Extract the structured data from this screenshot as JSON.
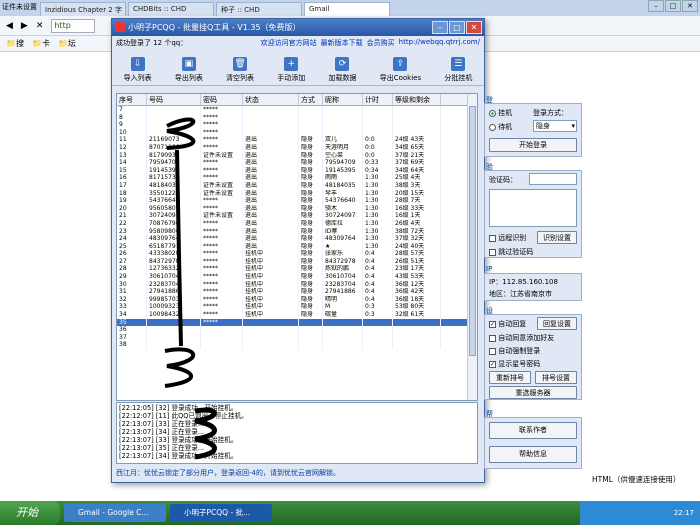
{
  "browser": {
    "window_title": "证件未设置",
    "tabs": [
      "Inzidious Chapter 2 字",
      "CHDBits :: CHD",
      "种子 :: CHD",
      "Gmail"
    ],
    "address_text": "http",
    "bookmarks": [
      "搜",
      "卡",
      "坛"
    ],
    "page_side_text": "HTML（供慢速连接使用）"
  },
  "app": {
    "title": "小明子PCQQ - 批量挂Q工具 - V1.35（免费版）",
    "login_info": "成功登录了 12 个qq：",
    "links": [
      "欢迎访问官方网站",
      "最新版本下载",
      "会员购买",
      "http://webqq.qtrrj.com/"
    ],
    "toolbar": [
      {
        "label": "导入列表",
        "icon": "import-icon"
      },
      {
        "label": "导出列表",
        "icon": "export-icon"
      },
      {
        "label": "清空列表",
        "icon": "trash-icon"
      },
      {
        "label": "手动添加",
        "icon": "add-icon"
      },
      {
        "label": "加载数据",
        "icon": "load-icon"
      },
      {
        "label": "导出Cookies",
        "icon": "cookie-icon"
      },
      {
        "label": "分批挂机",
        "icon": "batch-icon"
      }
    ],
    "columns": [
      "序号",
      "号码",
      "密码",
      "状态",
      "方式",
      "昵称",
      "计时",
      "等级和剩余"
    ],
    "rows": [
      [
        "7",
        "",
        "*****",
        "",
        "",
        "",
        "",
        ""
      ],
      [
        "8",
        "",
        "*****",
        "",
        "",
        "",
        "",
        ""
      ],
      [
        "9",
        "",
        "*****",
        "",
        "",
        "",
        "",
        ""
      ],
      [
        "10",
        "",
        "*****",
        "",
        "",
        "",
        "",
        ""
      ],
      [
        "11",
        "21169073",
        "*****",
        "退出",
        "隐身",
        "双儿",
        "0:0",
        "24级 43天"
      ],
      [
        "12",
        "87071160",
        "*****",
        "退出",
        "隐身",
        "天涯明月",
        "0:0",
        "34级 65天"
      ],
      [
        "13",
        "81790936",
        "证件未设置",
        "退出",
        "隐身",
        "空心菜",
        "0:0",
        "37级 21天"
      ],
      [
        "14",
        "79594709",
        "*****",
        "退出",
        "隐身",
        "79594709",
        "0:33",
        "37级 69天"
      ],
      [
        "15",
        "19145395",
        "*****",
        "退出",
        "隐身",
        "19145395",
        "0:34",
        "34级 64天"
      ],
      [
        "16",
        "81715730",
        "*****",
        "退出",
        "隐身",
        "雨雨",
        "1:30",
        "25级 4天"
      ],
      [
        "17",
        "48184035",
        "证件未设置",
        "退出",
        "隐身",
        "48184035",
        "1:30",
        "38级 3天"
      ],
      [
        "18",
        "35501221",
        "证件未设置",
        "退出",
        "隐身",
        "琴丰",
        "1:30",
        "20级 15天"
      ],
      [
        "19",
        "54376640",
        "*****",
        "退出",
        "隐身",
        "54376640",
        "1:30",
        "28级 7天"
      ],
      [
        "20",
        "95605806",
        "*****",
        "退出",
        "隐身",
        "骑木",
        "1:30",
        "16级 33天"
      ],
      [
        "21",
        "30724097",
        "证件未设置",
        "退出",
        "隐身",
        "30724097",
        "1:30",
        "16级 1天"
      ],
      [
        "22",
        "70876796",
        "*****",
        "退出",
        "隐身",
        "德库拉",
        "1:30",
        "26级 4天"
      ],
      [
        "23",
        "95809806",
        "*****",
        "退出",
        "隐身",
        "ID寨",
        "1:30",
        "38级 72天"
      ],
      [
        "24",
        "48309764",
        "*****",
        "退出",
        "隐身",
        "48309764",
        "1:30",
        "37级 32天"
      ],
      [
        "25",
        "65187791",
        "*****",
        "退出",
        "隐身",
        "★",
        "1:30",
        "24级 40天"
      ],
      [
        "26",
        "43338028",
        "*****",
        "挂机中",
        "隐身",
        "张家乐",
        "0:4",
        "28级 57天"
      ],
      [
        "27",
        "84372978",
        "*****",
        "挂机中",
        "隐身",
        "84372978",
        "0:4",
        "26级 51天"
      ],
      [
        "28",
        "12736332",
        "*****",
        "挂机中",
        "隐身",
        "炼狱的鹏",
        "0:4",
        "23级 17天"
      ],
      [
        "29",
        "30610704",
        "*****",
        "挂机中",
        "隐身",
        "30610704",
        "0:4",
        "43级 53天"
      ],
      [
        "30",
        "23283704",
        "*****",
        "挂机中",
        "隐身",
        "23283704",
        "0:4",
        "36级 12天"
      ],
      [
        "31",
        "27941886",
        "*****",
        "挂机中",
        "隐身",
        "27941886",
        "0:4",
        "36级 42天"
      ],
      [
        "32",
        "99985703",
        "*****",
        "挂机中",
        "隐身",
        "晴明",
        "0:4",
        "36级 18天"
      ],
      [
        "33",
        "10009323",
        "*****",
        "挂机中",
        "隐身",
        "M",
        "0:3",
        "53级 80天"
      ],
      [
        "34",
        "10098432",
        "*****",
        "挂机中",
        "隐身",
        "碳量",
        "0:3",
        "32级 61天"
      ],
      [
        "35",
        "",
        "*****",
        "",
        "",
        "",
        "",
        ""
      ],
      [
        "36",
        "",
        "",
        "",
        "",
        "",
        "",
        ""
      ],
      [
        "37",
        "",
        "",
        "",
        "",
        "",
        "",
        ""
      ],
      [
        "38",
        "",
        "",
        "",
        "",
        "",
        "",
        ""
      ]
    ],
    "logs": [
      "[22:12:05] [32] 登录成功，开始挂机。",
      "[22:12:07] [11] 此QQ已退出，停止挂机。",
      "[22:13:07] [33] 正在登录...",
      "[22:13:07] [34] 正在登录...",
      "[22:13:07] [33] 登录成功，开始挂机。",
      "[22:13:07] [35] 正在登录...",
      "[22:13:07] [34] 登录成功，开始挂机。"
    ],
    "status": "西江月：忧忧云锁定了部分用户，登录返回-4的，请到忧忧云官网解锁。",
    "login_panel": {
      "title": "登录",
      "radio_hang": "挂机",
      "radio_wait": "待机",
      "mode_label": "登录方式：",
      "mode_value": "隐身",
      "start_btn": "开始登录"
    },
    "captcha_panel": {
      "title": "验证码",
      "label": "验证码：",
      "remote_chk": "远程识别",
      "remote_btn": "识别设置",
      "skip_chk": "跳过验证码"
    },
    "ip_panel": {
      "title": "IP信息",
      "ip": "IP：112.85.160.108",
      "region": "地区：江苏省南京市"
    },
    "settings_panel": {
      "title": "设置",
      "auto_reply": "自动回复",
      "reply_btn": "回复设置",
      "auto_friend": "自动同意添加好友",
      "auto_force": "自动强制登录",
      "show_stars": "显示星号密码",
      "renumber_btn": "重新排号",
      "order_btn": "排号设置",
      "reselect_btn": "重选服务器"
    },
    "help_panel": {
      "title": "帮助",
      "contact_btn": "联系作者",
      "help_btn": "帮助信息"
    }
  },
  "taskbar": {
    "start": "开始",
    "tasks": [
      "Gmail - Google C...",
      "小明子PCQQ - 批..."
    ],
    "clock": "22:17"
  }
}
